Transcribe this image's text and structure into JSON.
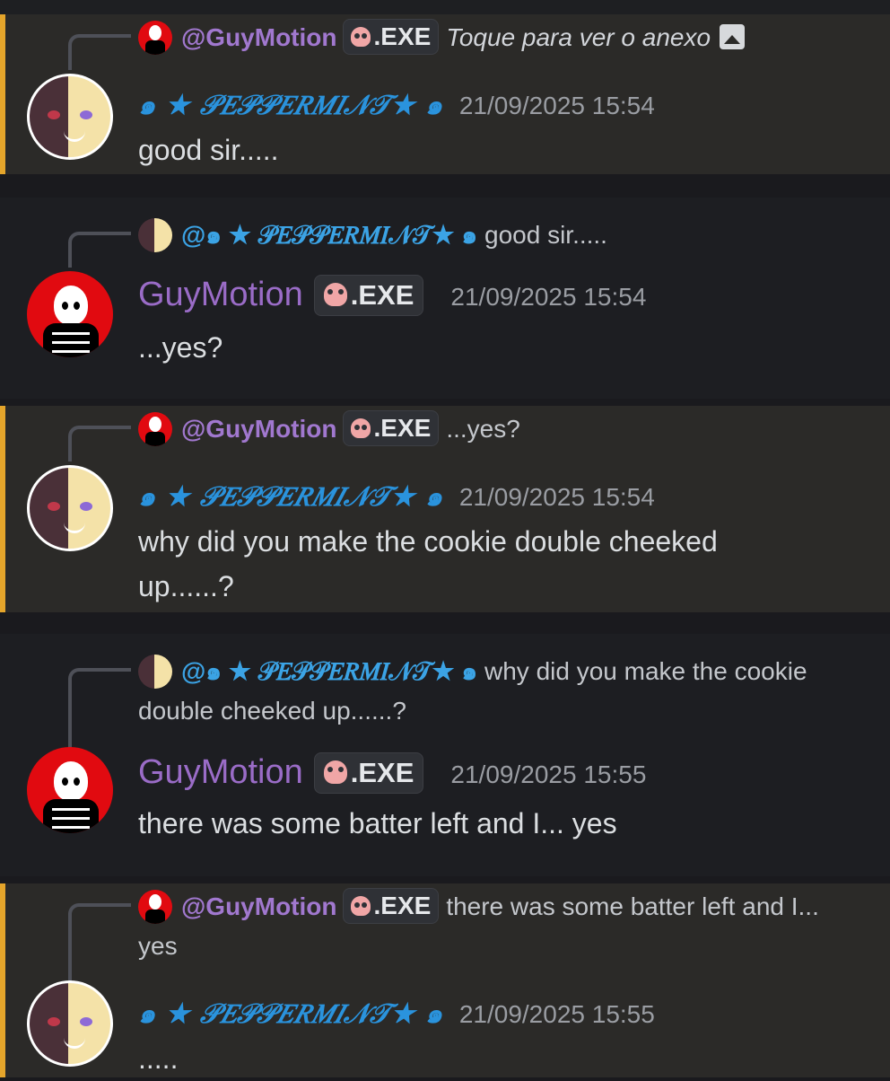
{
  "colors": {
    "highlight_bar": "#e5a52b",
    "peppermint_name": "#2a93dd",
    "guymotion_name": "#9a6cc7",
    "timestamp": "#9a9da3"
  },
  "messages": [
    {
      "reply": {
        "mention": "@GuyMotion",
        "tag": ".EXE",
        "preview": "Toque para ver o anexo"
      },
      "author": "๑ ★ 𝒫𝐸𝒫𝒫𝐸𝑅𝑀𝐼𝒩𝒯★ ๑",
      "timestamp": "21/09/2025 15:54",
      "text": "good sir....."
    },
    {
      "reply": {
        "mention": "@๑ ★ 𝒫𝐸𝒫𝒫𝐸𝑅𝑀𝐼𝒩𝒯★ ๑",
        "preview": "good sir....."
      },
      "author": "GuyMotion",
      "tag": ".EXE",
      "timestamp": "21/09/2025 15:54",
      "text": "...yes?"
    },
    {
      "reply": {
        "mention": "@GuyMotion",
        "tag": ".EXE",
        "preview": "...yes?"
      },
      "author": "๑ ★ 𝒫𝐸𝒫𝒫𝐸𝑅𝑀𝐼𝒩𝒯★ ๑",
      "timestamp": "21/09/2025 15:54",
      "text": "why did you make the cookie double cheeked up......?"
    },
    {
      "reply": {
        "mention": "@๑ ★ 𝒫𝐸𝒫𝒫𝐸𝑅𝑀𝐼𝒩𝒯★ ๑",
        "preview": "why did you make the cookie double cheeked up......?"
      },
      "author": "GuyMotion",
      "tag": ".EXE",
      "timestamp": "21/09/2025 15:55",
      "text": "there was some batter left and I... yes"
    },
    {
      "reply": {
        "mention": "@GuyMotion",
        "tag": ".EXE",
        "preview": "there was some batter left and I... yes"
      },
      "author": "๑ ★ 𝒫𝐸𝒫𝒫𝐸𝑅𝑀𝐼𝒩𝒯★ ๑",
      "timestamp": "21/09/2025 15:55",
      "text": "....."
    }
  ]
}
